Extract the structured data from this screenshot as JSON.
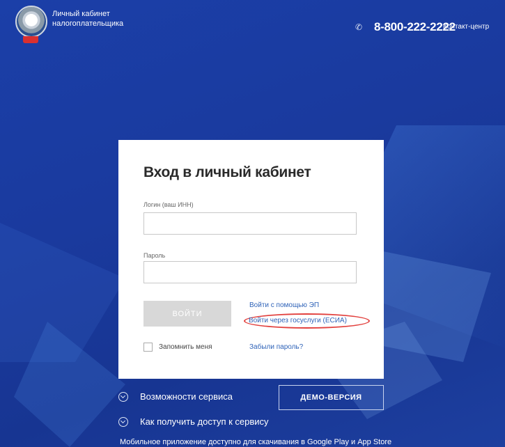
{
  "header": {
    "title_line1": "Личный кабинет",
    "title_line2": "налогоплательщика",
    "phone": "8-800-222-2222",
    "contact_center": "Контакт-центр"
  },
  "login_form": {
    "heading": "Вход в личный кабинет",
    "login_label": "Логин (ваш ИНН)",
    "login_value": "",
    "password_label": "Пароль",
    "password_value": "",
    "login_button": "ВОЙТИ",
    "link_ep": "Войти с помощью ЭП",
    "link_esia": "Войти через госуслуги (ЕСИА)",
    "remember_label": "Запомнить меня",
    "forgot_password": "Забыли пароль?"
  },
  "footer": {
    "features_link": "Возможности сервиса",
    "access_link": "Как получить доступ к сервису",
    "demo_button": "ДЕМО-ВЕРСИЯ",
    "mobile_note": "Мобильное приложение доступно для скачивания в Google Play и App Store"
  },
  "colors": {
    "background": "#1a3a9e",
    "link": "#2f63b8",
    "highlight_oval": "#e2403d"
  }
}
